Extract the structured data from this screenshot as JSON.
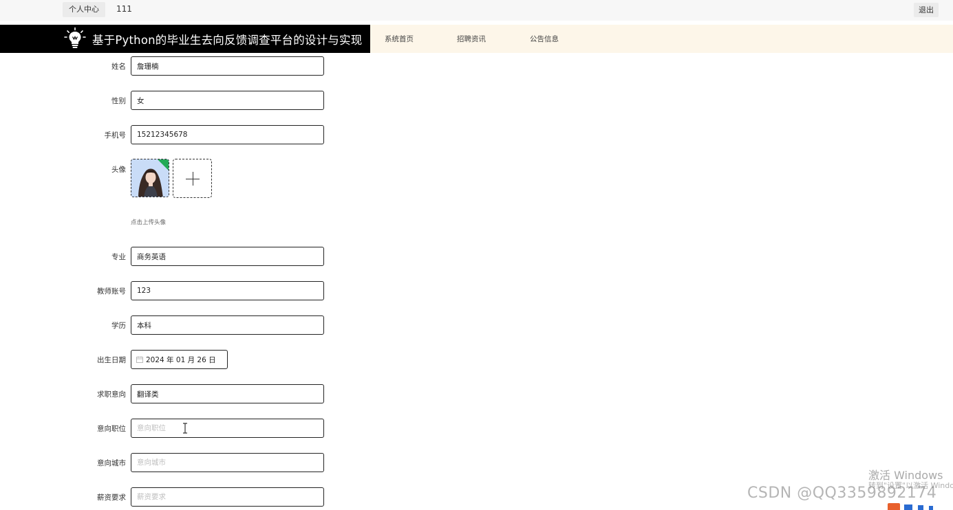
{
  "topbar": {
    "personal_center": "个人中心",
    "username": "111",
    "logout": "退出"
  },
  "header": {
    "title": "基于Python的毕业生去向反馈调查平台的设计与实现"
  },
  "nav": [
    {
      "label": "系统首页"
    },
    {
      "label": "招聘资讯"
    },
    {
      "label": "公告信息"
    }
  ],
  "form": {
    "name": {
      "label": "姓名",
      "value": "詹珊楠",
      "placeholder": ""
    },
    "gender": {
      "label": "性别",
      "value": "女",
      "placeholder": ""
    },
    "phone": {
      "label": "手机号",
      "value": "15212345678",
      "placeholder": ""
    },
    "avatar": {
      "label": "头像",
      "tip": "点击上传头像"
    },
    "major": {
      "label": "专业",
      "value": "商务英语",
      "placeholder": ""
    },
    "teacher_id": {
      "label": "教师账号",
      "value": "123",
      "placeholder": ""
    },
    "education": {
      "label": "学历",
      "value": "本科",
      "placeholder": ""
    },
    "birthday": {
      "label": "出生日期",
      "value": "2024 年 01 月 26 日"
    },
    "intention": {
      "label": "求职意向",
      "value": "翻译类",
      "placeholder": ""
    },
    "position": {
      "label": "意向职位",
      "value": "",
      "placeholder": "意向职位"
    },
    "city": {
      "label": "意向城市",
      "value": "",
      "placeholder": "意向城市"
    },
    "salary": {
      "label": "薪资要求",
      "value": "",
      "placeholder": "薪资要求"
    }
  },
  "watermarks": {
    "windows_line1": "激活 Windows",
    "windows_line2": "转到\"设置\"以激活 Windows。",
    "csdn": "CSDN @QQ3359892174"
  },
  "colors": {
    "brand_bg": "#000000",
    "nav_bg": "#fdf6e9",
    "topbar_bg": "#f7f7f7",
    "input_border": "#222222"
  }
}
